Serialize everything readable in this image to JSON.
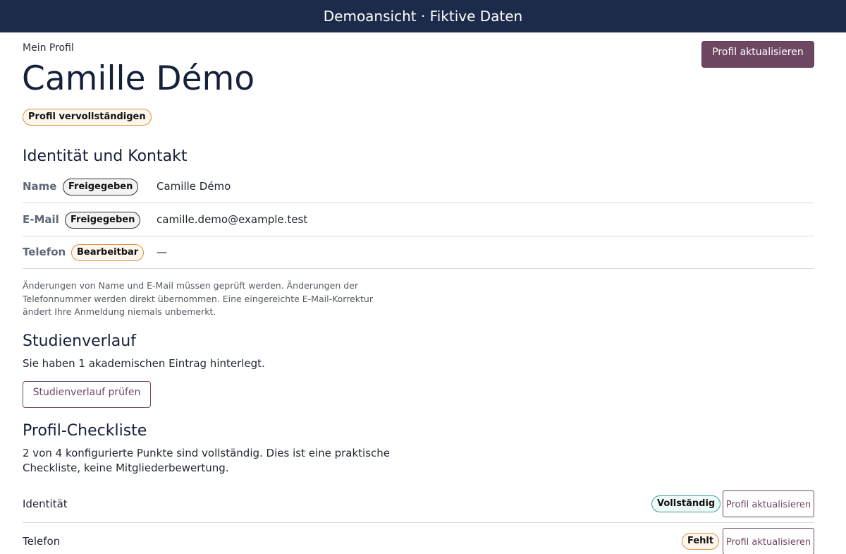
{
  "banner": "Demoansicht · Fiktive Daten",
  "header": {
    "eyebrow": "Mein Profil",
    "name": "Camille Démo",
    "update_button": "Profil aktualisieren",
    "status_badge": "Profil vervollständigen"
  },
  "identity": {
    "heading": "Identität und Kontakt",
    "rows": [
      {
        "label": "Name",
        "badge": "Freigegeben",
        "value": "Camille Démo"
      },
      {
        "label": "E-Mail",
        "badge": "Freigegeben",
        "value": "camille.demo@example.test"
      },
      {
        "label": "Telefon",
        "badge": "Bearbeitbar",
        "value": "—"
      }
    ],
    "note": "Änderungen von Name und E-Mail müssen geprüft werden. Änderungen der Telefonnummer werden direkt übernommen. Eine eingereichte E-Mail-Korrektur ändert Ihre Anmeldung niemals unbemerkt."
  },
  "study": {
    "heading": "Studienverlauf",
    "text": "Sie haben 1 akademischen Eintrag hinterlegt.",
    "button": "Studienverlauf prüfen"
  },
  "checklist": {
    "heading": "Profil-Checkliste",
    "summary": "2 von 4 konfigurierte Punkte sind vollständig. Dies ist eine praktische Checkliste, keine Mitgliederbewertung.",
    "items": [
      {
        "label": "Identität",
        "status": "Vollständig",
        "button": "Profil aktualisieren"
      },
      {
        "label": "Telefon",
        "status": "Fehlt",
        "button": "Profil aktualisieren"
      }
    ]
  },
  "colors": {
    "banner_bg": "#1c2b4a",
    "accent": "#6e4763",
    "badge_warning_border": "#d9923f",
    "badge_success_border": "#3e9c9a"
  }
}
